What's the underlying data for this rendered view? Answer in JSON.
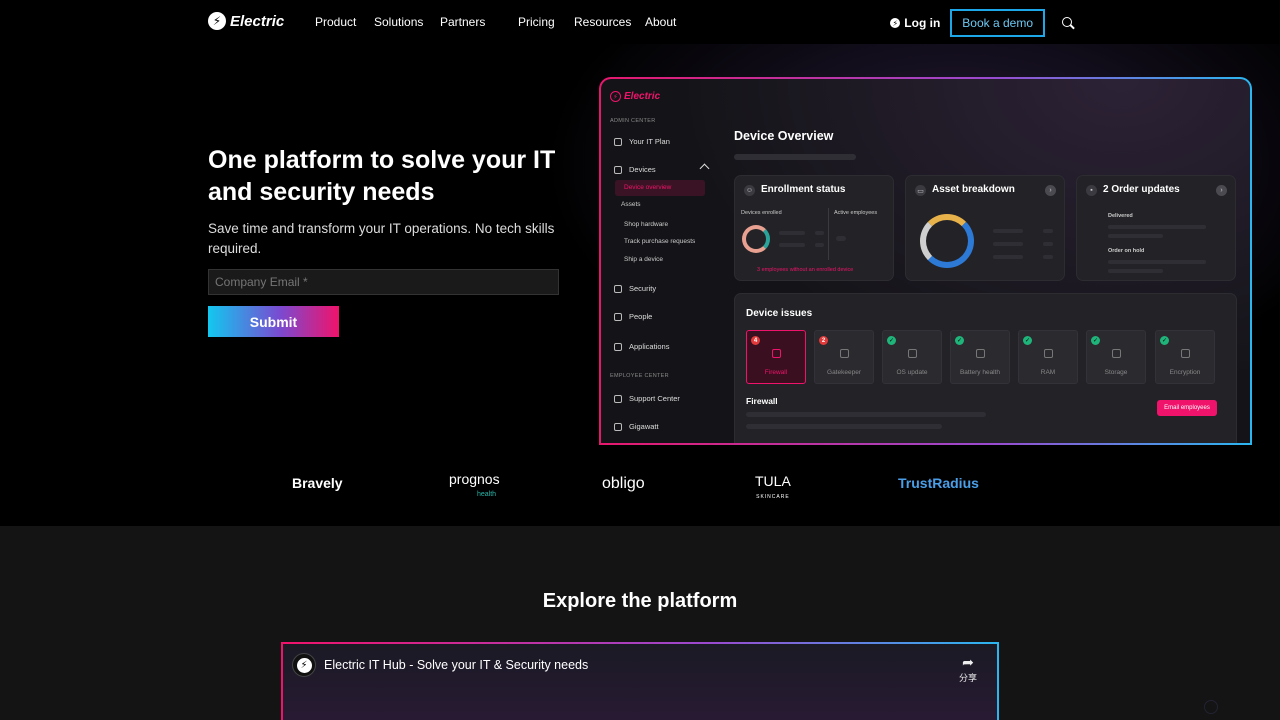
{
  "brand": {
    "name": "Electric",
    "bolt": "⚡"
  },
  "nav": {
    "items": [
      "Product",
      "Solutions",
      "Partners",
      "Pricing",
      "Resources",
      "About"
    ],
    "login": "Log in",
    "demo": "Book a demo"
  },
  "hero": {
    "title": "One platform to solve your IT and security needs",
    "subtitle": "Save time and transform your IT operations. No tech skills required.",
    "email_placeholder": "Company Email *",
    "submit": "Submit"
  },
  "app": {
    "logo": "Electric",
    "admin_center": "ADMIN CENTER",
    "employee_center": "EMPLOYEE CENTER",
    "sidebar": {
      "it_plan": "Your IT Plan",
      "devices": "Devices",
      "device_overview": "Device overview",
      "assets": "Assets",
      "shop_hardware": "Shop hardware",
      "track_requests": "Track purchase requests",
      "ship_device": "Ship a device",
      "security": "Security",
      "people": "People",
      "applications": "Applications",
      "support_center": "Support Center",
      "gigawatt": "Gigawatt"
    },
    "title": "Device Overview",
    "enrollment": {
      "title": "Enrollment status",
      "devices_enrolled": "Devices enrolled",
      "active_employees": "Active employees",
      "note": "3 employees without an enrolled device"
    },
    "asset_breakdown": {
      "title": "Asset breakdown"
    },
    "orders": {
      "title": "2 Order updates",
      "delivered": "Delivered",
      "on_hold": "Order on hold"
    },
    "issues": {
      "title": "Device issues",
      "tiles": [
        {
          "label": "Firewall",
          "badge": "4",
          "status": "red"
        },
        {
          "label": "Gatekeeper",
          "badge": "2",
          "status": "red"
        },
        {
          "label": "OS update",
          "badge": "✓",
          "status": "green"
        },
        {
          "label": "Battery health",
          "badge": "✓",
          "status": "green"
        },
        {
          "label": "RAM",
          "badge": "✓",
          "status": "green"
        },
        {
          "label": "Storage",
          "badge": "✓",
          "status": "green"
        },
        {
          "label": "Encryption",
          "badge": "✓",
          "status": "green"
        }
      ],
      "detail_title": "Firewall",
      "email_button": "Email employees"
    }
  },
  "logos": {
    "bravely": "Bravely",
    "prognos": "prognos",
    "prognos_sub": "health",
    "obligo": "obligo",
    "tula": "TULA",
    "tula_sub": "SKINCARE",
    "trustradius": "TrustRadius"
  },
  "explore": {
    "title": "Explore the platform",
    "video_title": "Electric IT Hub - Solve your IT & Security needs",
    "share": "分享"
  },
  "colors": {
    "accent_pink": "#f0136b",
    "accent_blue": "#1ea7e8"
  }
}
